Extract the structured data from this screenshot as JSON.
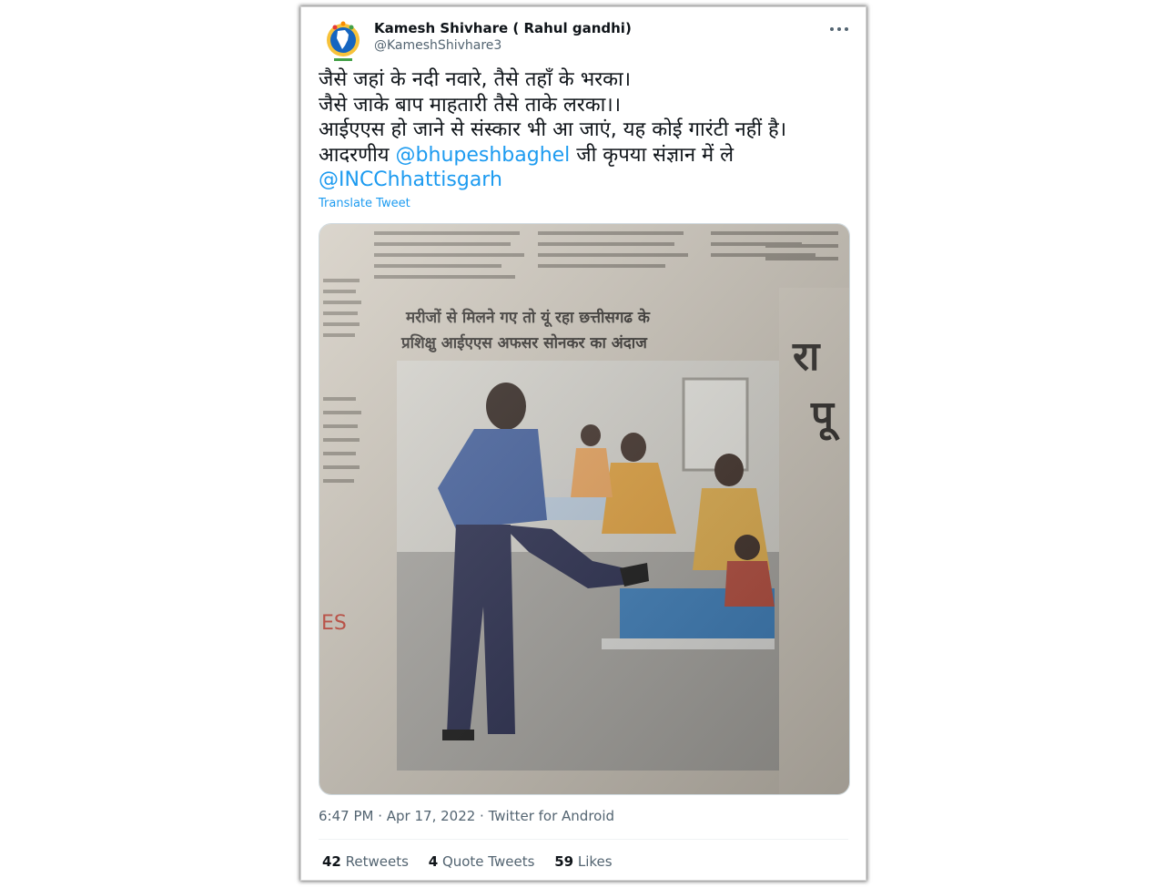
{
  "tweet": {
    "author_name": "Kamesh Shivhare ( Rahul gandhi)",
    "author_handle": "@KameshShivhare3",
    "more_icon": "more-horizontal-icon",
    "lines": [
      {
        "text": "जैसे जहां के नदी नवारे, तैसे तहाँ के भरका।"
      },
      {
        "text": "जैसे जाके बाप माहतारी तैसे ताके लरका।।"
      },
      {
        "text": "आईएएस हो जाने से संस्कार भी आ जाएं, यह कोई गारंटी नहीं है।"
      },
      {
        "prefix": "आदरणीय ",
        "mention": "@bhupeshbaghel",
        "suffix": " जी कृपया संज्ञान में ले"
      },
      {
        "mention": "@INCChhattisgarh"
      }
    ],
    "translate_label": "Translate Tweet",
    "media": {
      "headline_line1": "मरीजों से मिलने गए तो यूं रहा छत्तीसगढ के",
      "headline_line2": "प्रशिक्षु आईएएस अफसर सोनकर का अंदाज",
      "side_fragment_1": "रा",
      "side_fragment_2": "पू"
    },
    "time": "6:47 PM",
    "date": "Apr 17, 2022",
    "source": "Twitter for Android",
    "separator": " · ",
    "stats": {
      "retweets_count": "42",
      "retweets_label": "Retweets",
      "quotes_count": "4",
      "quotes_label": "Quote Tweets",
      "likes_count": "59",
      "likes_label": "Likes"
    }
  },
  "colors": {
    "link": "#1d9bf0",
    "text_primary": "#0f1419",
    "text_secondary": "#536471"
  }
}
